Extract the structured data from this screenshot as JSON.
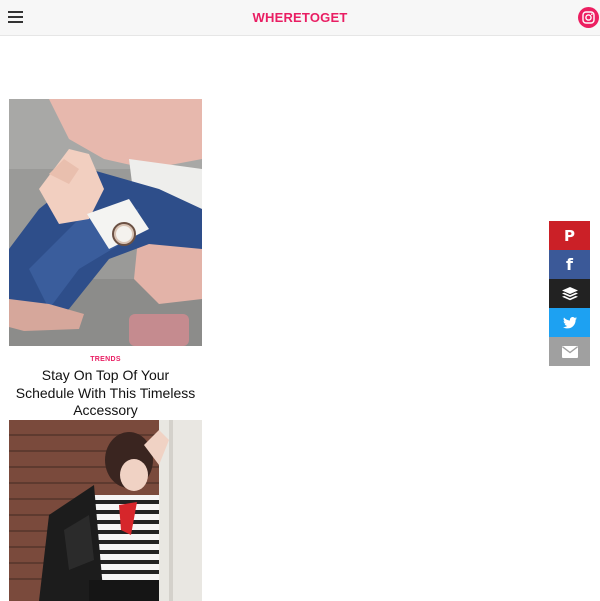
{
  "header": {
    "brand": "WHERETOGET",
    "menu_icon": "hamburger-menu-icon",
    "camera_icon": "instagram-camera-icon"
  },
  "colors": {
    "accent": "#e91e63",
    "pinterest": "#cb2027",
    "facebook": "#3b5998",
    "buffer": "#222222",
    "twitter": "#1da1f2",
    "email": "#a0a0a0"
  },
  "feed": {
    "cards": [
      {
        "image": "woman-wrist-watch-photo",
        "category": "TRENDS",
        "title": "Stay On Top Of Your Schedule With This Timeless Accessory"
      },
      {
        "image": "woman-striped-top-leather-jacket-photo"
      }
    ]
  },
  "share": {
    "buttons": [
      {
        "icon": "pinterest-icon",
        "glyph": "P"
      },
      {
        "icon": "facebook-icon",
        "glyph": "f"
      },
      {
        "icon": "buffer-icon"
      },
      {
        "icon": "twitter-icon"
      },
      {
        "icon": "email-icon"
      }
    ]
  }
}
